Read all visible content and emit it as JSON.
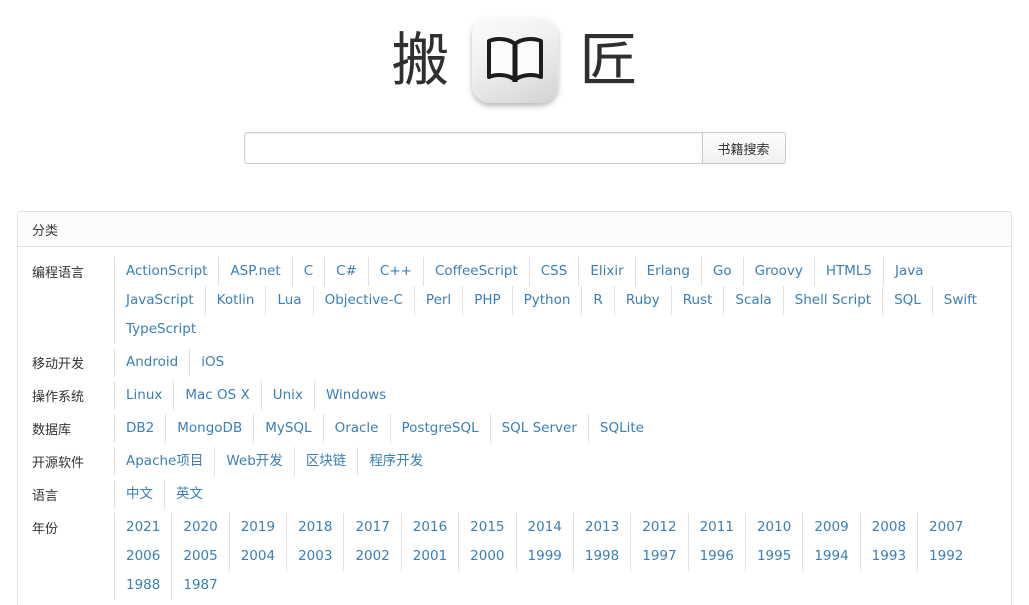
{
  "logo": {
    "left_char": "搬",
    "right_char": "匠",
    "icon": "open-book-icon",
    "site_name": "搬匠"
  },
  "search": {
    "value": "",
    "placeholder": "",
    "button_label": "书籍搜索"
  },
  "panel": {
    "heading": "分类",
    "rows": [
      {
        "label": "编程语言",
        "links": [
          "ActionScript",
          "ASP.net",
          "C",
          "C#",
          "C++",
          "CoffeeScript",
          "CSS",
          "Elixir",
          "Erlang",
          "Go",
          "Groovy",
          "HTML5",
          "Java",
          "JavaScript",
          "Kotlin",
          "Lua",
          "Objective-C",
          "Perl",
          "PHP",
          "Python",
          "R",
          "Ruby",
          "Rust",
          "Scala",
          "Shell Script",
          "SQL",
          "Swift",
          "TypeScript"
        ]
      },
      {
        "label": "移动开发",
        "links": [
          "Android",
          "iOS"
        ]
      },
      {
        "label": "操作系统",
        "links": [
          "Linux",
          "Mac OS X",
          "Unix",
          "Windows"
        ]
      },
      {
        "label": "数据库",
        "links": [
          "DB2",
          "MongoDB",
          "MySQL",
          "Oracle",
          "PostgreSQL",
          "SQL Server",
          "SQLite"
        ]
      },
      {
        "label": "开源软件",
        "links": [
          "Apache项目",
          "Web开发",
          "区块链",
          "程序开发"
        ]
      },
      {
        "label": "语言",
        "links": [
          "中文",
          "英文"
        ]
      },
      {
        "label": "年份",
        "links": [
          "2021",
          "2020",
          "2019",
          "2018",
          "2017",
          "2016",
          "2015",
          "2014",
          "2013",
          "2012",
          "2011",
          "2010",
          "2009",
          "2008",
          "2007",
          "2006",
          "2005",
          "2004",
          "2003",
          "2002",
          "2001",
          "2000",
          "1999",
          "1998",
          "1997",
          "1996",
          "1995",
          "1994",
          "1993",
          "1992",
          "1988",
          "1987"
        ]
      }
    ]
  },
  "colors": {
    "link": "#3a7fb5",
    "label": "#333333",
    "border": "#e3e3e3",
    "separator": "#e0e0e0",
    "panel_heading_bg": "#fcfcfc",
    "page_bg": "#ffffff"
  }
}
